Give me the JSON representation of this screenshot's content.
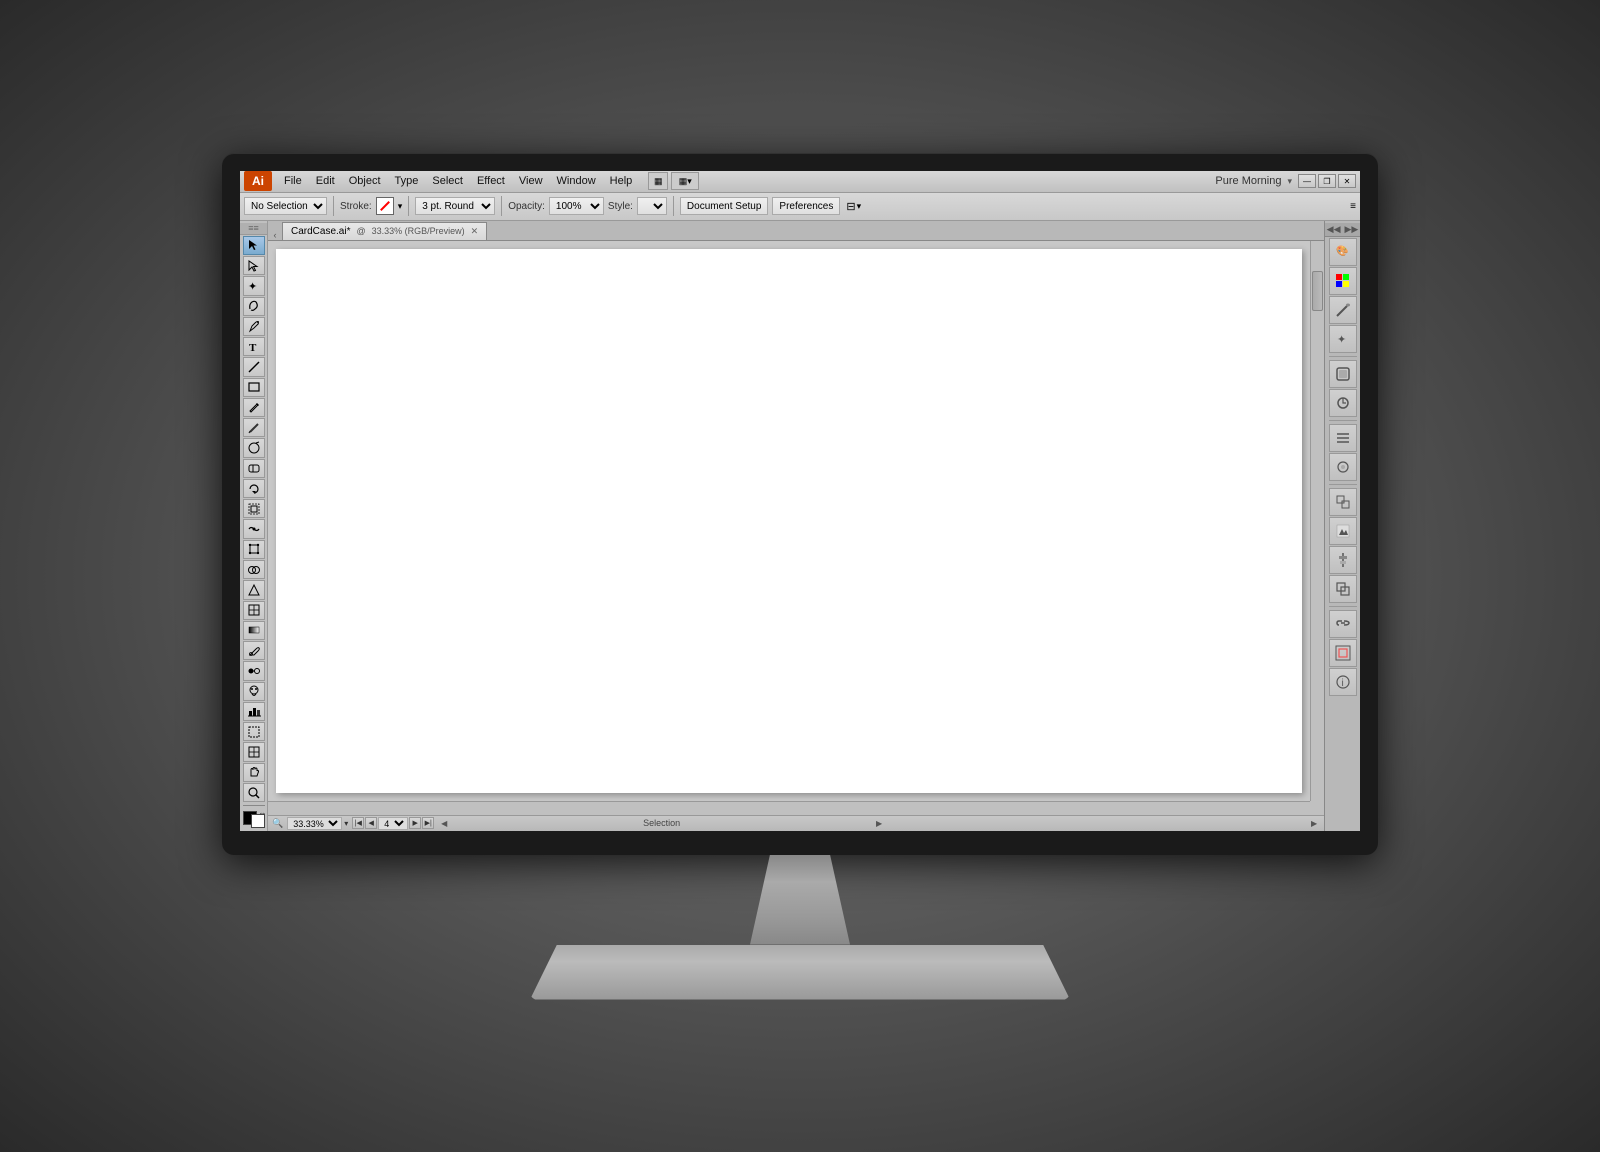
{
  "app": {
    "logo": "Ai",
    "title": "Pure Morning",
    "workspace_label": "Pure Morning"
  },
  "menu": {
    "items": [
      "File",
      "Edit",
      "Object",
      "Type",
      "Select",
      "Effect",
      "View",
      "Window",
      "Help"
    ]
  },
  "window_controls": {
    "minimize": "—",
    "restore": "❐",
    "close": "✕"
  },
  "toolbar": {
    "selection_label": "No Selection",
    "stroke_label": "Stroke:",
    "stroke_value": "",
    "opacity_label": "Opacity:",
    "opacity_value": "100%",
    "style_label": "Style:",
    "weight_value": "3 pt. Round",
    "document_setup": "Document Setup",
    "preferences": "Preferences"
  },
  "document": {
    "tab_name": "CardCase.ai*",
    "tab_detail": "33.33% (RGB/Preview)"
  },
  "status_bar": {
    "zoom": "33.33%",
    "page": "4",
    "tool_name": "Selection"
  },
  "tools": {
    "items": [
      {
        "name": "selection-tool",
        "icon": "▶"
      },
      {
        "name": "direct-selection-tool",
        "icon": "↖"
      },
      {
        "name": "magic-wand-tool",
        "icon": "✦"
      },
      {
        "name": "lasso-tool",
        "icon": "⌇"
      },
      {
        "name": "pen-tool",
        "icon": "✒"
      },
      {
        "name": "type-tool",
        "icon": "T"
      },
      {
        "name": "line-tool",
        "icon": "/"
      },
      {
        "name": "rectangle-tool",
        "icon": "▭"
      },
      {
        "name": "pencil-tool",
        "icon": "✏"
      },
      {
        "name": "brush-tool",
        "icon": "🖌"
      },
      {
        "name": "blob-brush-tool",
        "icon": "◉"
      },
      {
        "name": "eraser-tool",
        "icon": "◫"
      },
      {
        "name": "rotate-tool",
        "icon": "↺"
      },
      {
        "name": "scale-tool",
        "icon": "⤢"
      },
      {
        "name": "warp-tool",
        "icon": "≋"
      },
      {
        "name": "free-transform-tool",
        "icon": "⊹"
      },
      {
        "name": "shape-builder-tool",
        "icon": "⊕"
      },
      {
        "name": "perspective-tool",
        "icon": "⬡"
      },
      {
        "name": "mesh-tool",
        "icon": "⊞"
      },
      {
        "name": "gradient-tool",
        "icon": "◫"
      },
      {
        "name": "eyedropper-tool",
        "icon": "⌲"
      },
      {
        "name": "blend-tool",
        "icon": "∞"
      },
      {
        "name": "symbol-sprayer-tool",
        "icon": "⊛"
      },
      {
        "name": "column-graph-tool",
        "icon": "▦"
      },
      {
        "name": "artboard-tool",
        "icon": "▭"
      },
      {
        "name": "slice-tool",
        "icon": "⊡"
      },
      {
        "name": "hand-tool",
        "icon": "✋"
      },
      {
        "name": "zoom-tool",
        "icon": "⊕"
      }
    ]
  },
  "right_panel": {
    "items": [
      {
        "name": "color-icon",
        "icon": "🎨"
      },
      {
        "name": "swatches-icon",
        "icon": "▦"
      },
      {
        "name": "brush-icon",
        "icon": "🖌"
      },
      {
        "name": "symbols-icon",
        "icon": "✦"
      },
      {
        "name": "graphic-styles-icon",
        "icon": "◈"
      },
      {
        "name": "appearance-icon",
        "icon": "⊡"
      },
      {
        "name": "layers-icon",
        "icon": "☰"
      },
      {
        "name": "sun-icon",
        "icon": "☀"
      },
      {
        "name": "transform-icon",
        "icon": "⊹"
      },
      {
        "name": "image-trace-icon",
        "icon": "⬡"
      },
      {
        "name": "align-icon",
        "icon": "⊟"
      },
      {
        "name": "pathfinder-icon",
        "icon": "⊞"
      },
      {
        "name": "links-icon",
        "icon": "🔗"
      },
      {
        "name": "nav-icon",
        "icon": "◎"
      },
      {
        "name": "info-icon",
        "icon": "ℹ"
      }
    ]
  }
}
